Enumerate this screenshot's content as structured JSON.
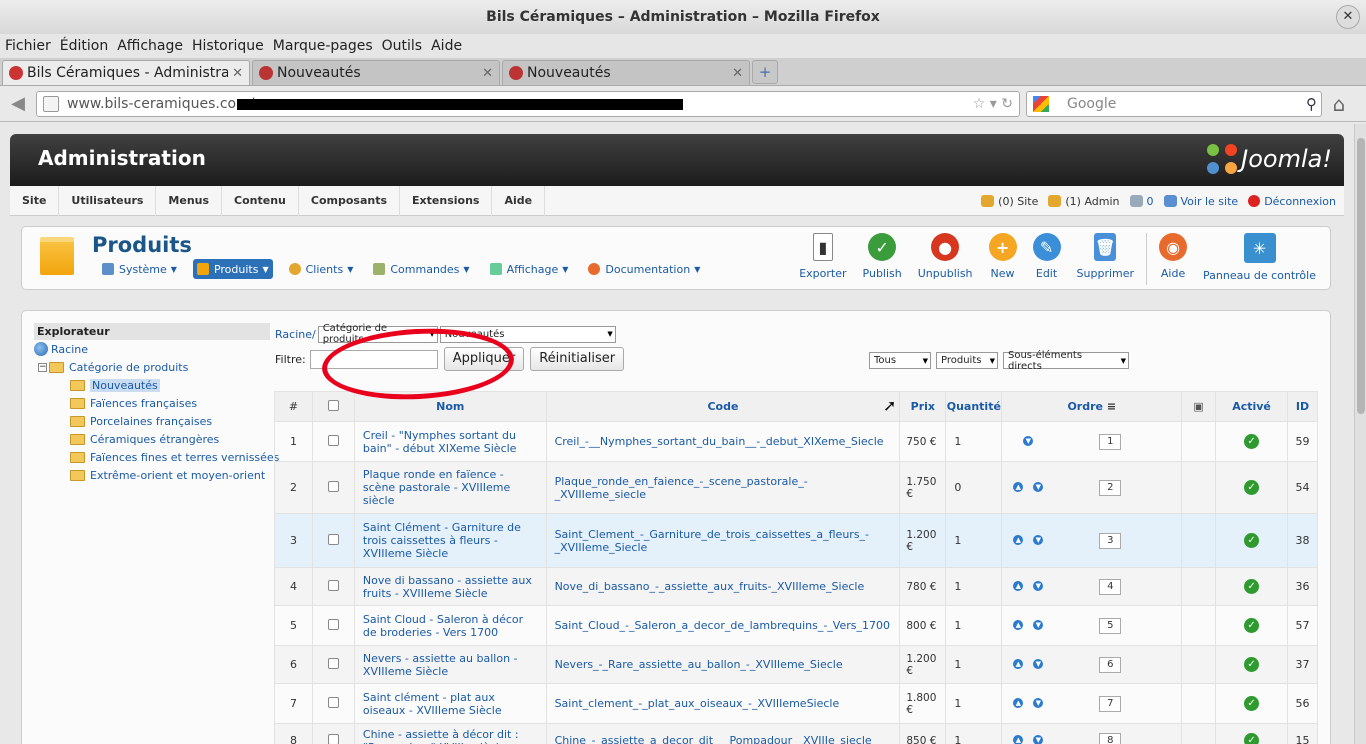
{
  "window": {
    "title": "Bils Céramiques – Administration – Mozilla Firefox"
  },
  "menubar": [
    "Fichier",
    "Édition",
    "Affichage",
    "Historique",
    "Marque-pages",
    "Outils",
    "Aide"
  ],
  "tabs": [
    {
      "label": "Bils Céramiques - Administra..."
    },
    {
      "label": "Nouveautés"
    },
    {
      "label": "Nouveautés"
    }
  ],
  "url": {
    "value": "www.bils-ceramiques.com/"
  },
  "search": {
    "placeholder": "Google"
  },
  "admin": {
    "title": "Administration",
    "logo": "Joomla!",
    "menu": [
      "Site",
      "Utilisateurs",
      "Menus",
      "Contenu",
      "Composants",
      "Extensions",
      "Aide"
    ],
    "status": {
      "site": "(0) Site",
      "admin": "(1) Admin",
      "messages": "0",
      "view_site": "Voir le site",
      "logout": "Déconnexion"
    }
  },
  "page": {
    "title": "Produits",
    "submenu": [
      "Système",
      "Produits",
      "Clients",
      "Commandes",
      "Affichage",
      "Documentation"
    ],
    "toolbar": [
      "Exporter",
      "Publish",
      "Unpublish",
      "New",
      "Edit",
      "Supprimer",
      "Aide",
      "Panneau de contrôle"
    ]
  },
  "explorer": {
    "header": "Explorateur",
    "root": "Racine",
    "category": "Catégorie de produits",
    "children": [
      "Nouveautés",
      "Faïences françaises",
      "Porcelaines françaises",
      "Céramiques étrangères",
      "Faïences fines et terres vernissées",
      "Extrême-orient et moyen-orient"
    ]
  },
  "filters": {
    "breadcrumb_root": "Racine/",
    "category_select": "Catégorie de produits",
    "sub_select": "Nouveautés",
    "filter_label": "Filtre:",
    "apply": "Appliquer",
    "reset": "Réinitialiser",
    "select_all": "Tous",
    "select_type": "Produits",
    "select_scope": "Sous-éléments directs"
  },
  "table": {
    "columns": [
      "#",
      "",
      "Nom",
      "Code",
      "Prix",
      "Quantité",
      "Ordre",
      "",
      "Activé",
      "ID"
    ],
    "rows": [
      {
        "n": "1",
        "name": "Creil - \"Nymphes sortant du bain\" - début XIXeme Siècle",
        "code": "Creil_-__Nymphes_sortant_du_bain__-_debut_XIXeme_Siecle",
        "price": "750 €",
        "qty": "1",
        "order": "1",
        "id": "59"
      },
      {
        "n": "2",
        "name": "Plaque ronde en faïence - scène pastorale - XVIIIeme siècle",
        "code": "Plaque_ronde_en_faience_-_scene_pastorale_-_XVIIIeme_siecle",
        "price": "1.750 €",
        "qty": "0",
        "order": "2",
        "id": "54"
      },
      {
        "n": "3",
        "name": "Saint Clément - Garniture de trois caissettes à fleurs - XVIIIeme Siècle",
        "code": "Saint_Clement_-_Garniture_de_trois_caissettes_a_fleurs_-_XVIIIeme_Siecle",
        "price": "1.200 €",
        "qty": "1",
        "order": "3",
        "id": "38"
      },
      {
        "n": "4",
        "name": "Nove di bassano - assiette aux fruits - XVIIIeme Siècle",
        "code": "Nove_di_bassano_-_assiette_aux_fruits-_XVIIIeme_Siecle",
        "price": "780 €",
        "qty": "1",
        "order": "4",
        "id": "36"
      },
      {
        "n": "5",
        "name": "Saint Cloud - Saleron à décor de broderies - Vers 1700",
        "code": "Saint_Cloud_-_Saleron_a_decor_de_lambrequins_-_Vers_1700",
        "price": "800 €",
        "qty": "1",
        "order": "5",
        "id": "57"
      },
      {
        "n": "6",
        "name": "Nevers - assiette au ballon - XVIIIeme Siècle",
        "code": "Nevers_-_Rare_assiette_au_ballon_-_XVIIIeme_Siecle",
        "price": "1.200 €",
        "qty": "1",
        "order": "6",
        "id": "37"
      },
      {
        "n": "7",
        "name": "Saint clément - plat aux oiseaux - XVIIIeme Siècle",
        "code": "Saint_clement_-_plat_aux_oiseaux_-_XVIIIemeSiecle",
        "price": "1.800 €",
        "qty": "1",
        "order": "7",
        "id": "56"
      },
      {
        "n": "8",
        "name": "Chine - assiette à décor dit : \"Pompadour\" XVIIIe siècle",
        "code": "Chine_-_assiette_a_decor_dit___Pompadour__XVIIIe_siecle",
        "price": "850 €",
        "qty": "1",
        "order": "8",
        "id": "15"
      }
    ]
  }
}
